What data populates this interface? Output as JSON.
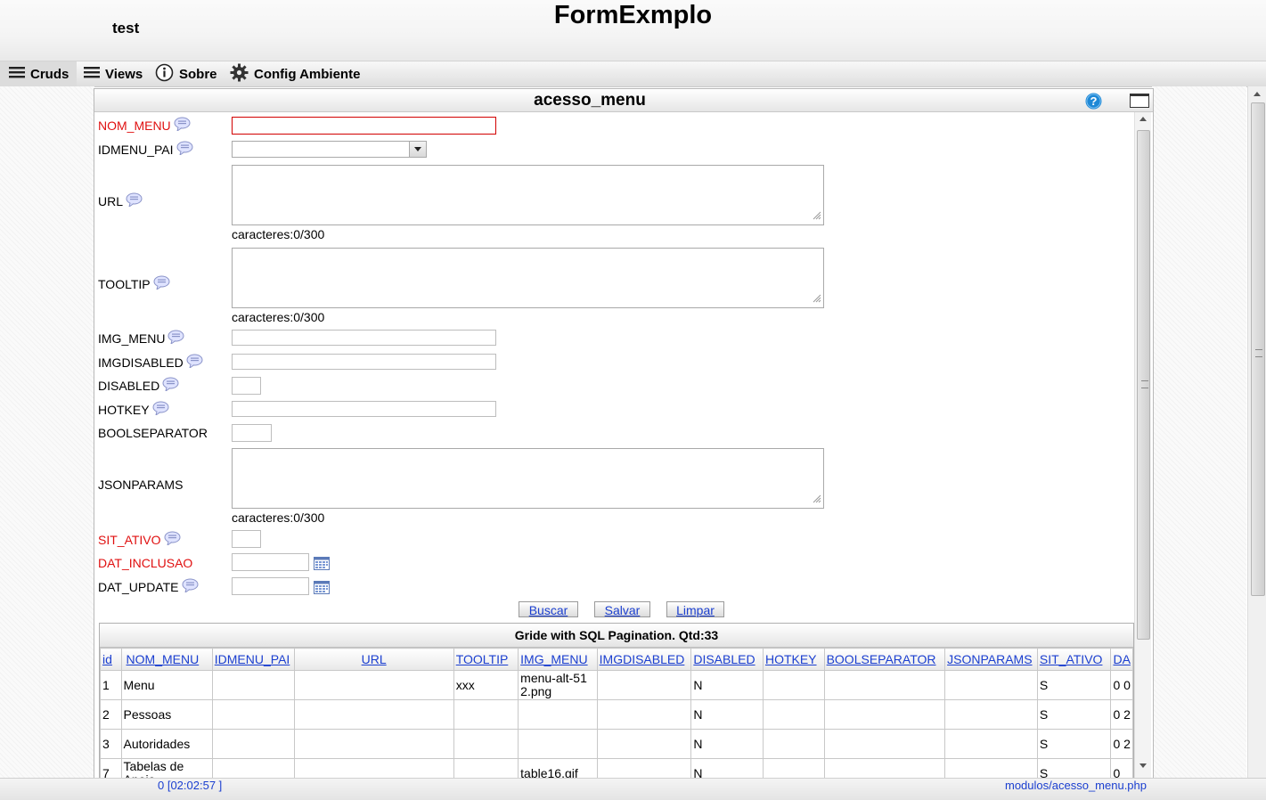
{
  "header": {
    "title": "FormExmplo",
    "user": "test"
  },
  "menu": [
    {
      "label": "Cruds",
      "icon": "hamburger-icon"
    },
    {
      "label": "Views",
      "icon": "hamburger-icon"
    },
    {
      "label": "Sobre",
      "icon": "info-icon"
    },
    {
      "label": "Config Ambiente",
      "icon": "gear-icon"
    }
  ],
  "form": {
    "title": "acesso_menu",
    "fields": {
      "nom_menu": {
        "label": "NOM_MENU",
        "required": true,
        "value": ""
      },
      "idmenu_pai": {
        "label": "IDMENU_PAI",
        "value": ""
      },
      "url": {
        "label": "URL",
        "value": "",
        "counter": "caracteres:0/300"
      },
      "tooltip": {
        "label": "TOOLTIP",
        "value": "",
        "counter": "caracteres:0/300"
      },
      "img_menu": {
        "label": "IMG_MENU",
        "value": ""
      },
      "imgdisabled": {
        "label": "IMGDISABLED",
        "value": ""
      },
      "disabled": {
        "label": "DISABLED",
        "value": ""
      },
      "hotkey": {
        "label": "HOTKEY",
        "value": ""
      },
      "boolseparator": {
        "label": "BOOLSEPARATOR",
        "value": ""
      },
      "jsonparams": {
        "label": "JSONPARAMS",
        "value": "",
        "counter": "caracteres:0/300"
      },
      "sit_ativo": {
        "label": "SIT_ATIVO",
        "required": true,
        "value": ""
      },
      "dat_inclusao": {
        "label": "DAT_INCLUSAO",
        "required": true,
        "value": ""
      },
      "dat_update": {
        "label": "DAT_UPDATE",
        "value": ""
      }
    },
    "buttons": {
      "search": "Buscar",
      "save": "Salvar",
      "clear": "Limpar"
    }
  },
  "grid": {
    "title": "Gride with SQL Pagination. Qtd:33",
    "columns": [
      "id",
      "NOM_MENU",
      "IDMENU_PAI",
      "URL",
      "TOOLTIP",
      "IMG_MENU",
      "IMGDISABLED",
      "DISABLED",
      "HOTKEY",
      "BOOLSEPARATOR",
      "JSONPARAMS",
      "SIT_ATIVO",
      "DA"
    ],
    "rows": [
      [
        "1",
        "Menu",
        "",
        "",
        "xxx",
        "menu-alt-512.png",
        "",
        "N",
        "",
        "",
        "",
        "S",
        "0 0"
      ],
      [
        "2",
        "Pessoas",
        "",
        "",
        "",
        "",
        "",
        "N",
        "",
        "",
        "",
        "S",
        "0 2"
      ],
      [
        "3",
        "Autoridades",
        "",
        "",
        "",
        "",
        "",
        "N",
        "",
        "",
        "",
        "S",
        "0 2"
      ],
      [
        "7",
        "Tabelas de Apoio",
        "",
        "",
        "",
        "table16.gif",
        "",
        "N",
        "",
        "",
        "",
        "S",
        "0"
      ]
    ]
  },
  "footer": {
    "left": "0 [02:02:57 ]",
    "right": "modulos/acesso_menu.php"
  },
  "colors": {
    "required": "#e01010",
    "link": "#1b3fd0",
    "help": "#1e88d6"
  }
}
